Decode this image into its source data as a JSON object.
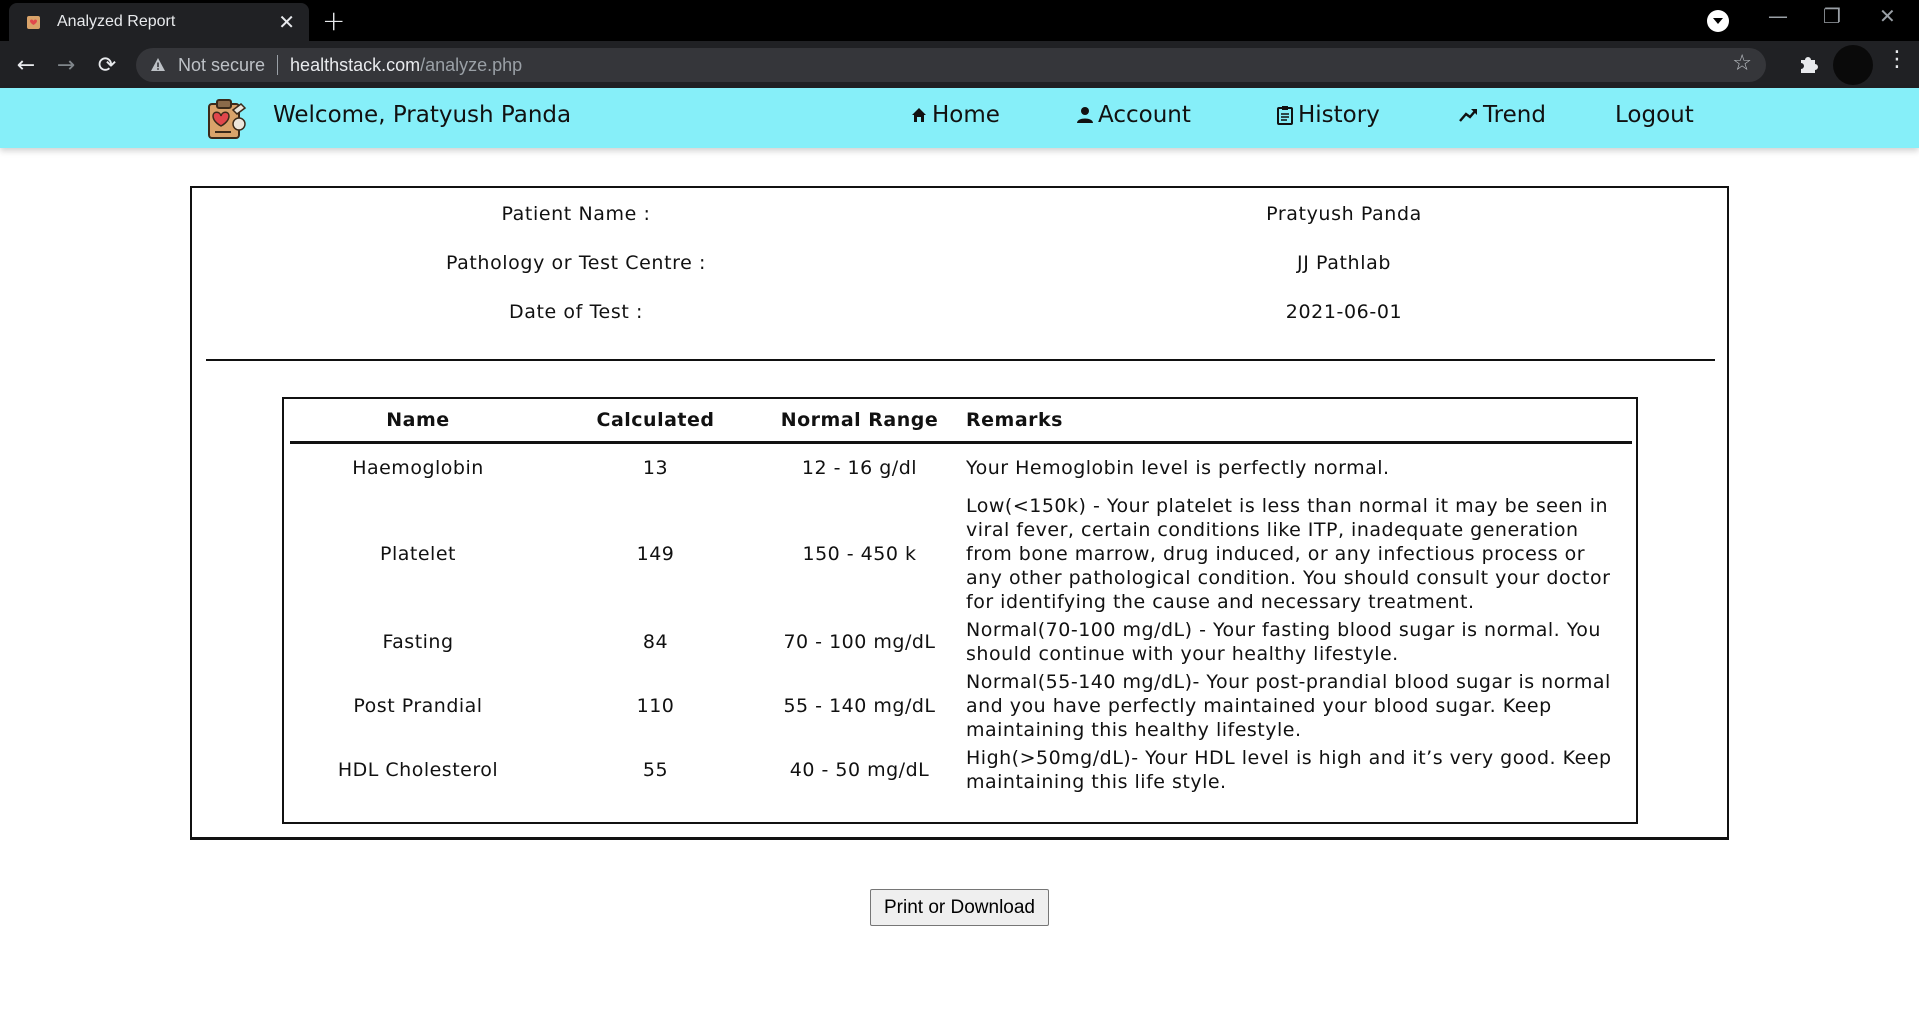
{
  "browser": {
    "tab_title": "Analyzed Report",
    "tab_close": "✕",
    "new_tab": "+",
    "security_label": "Not secure",
    "url_host": "healthstack.com",
    "url_path": "/analyze.php"
  },
  "navbar": {
    "welcome": "Welcome, Pratyush Panda",
    "links": [
      {
        "label": "Home",
        "icon": "home-icon"
      },
      {
        "label": "Account",
        "icon": "user-icon"
      },
      {
        "label": "History",
        "icon": "clipboard-icon"
      },
      {
        "label": "Trend",
        "icon": "trend-icon"
      },
      {
        "label": "Logout",
        "icon": ""
      }
    ],
    "background": "#86eff9"
  },
  "report": {
    "info": [
      {
        "label": "Patient Name :",
        "value": "Pratyush Panda"
      },
      {
        "label": "Pathology or Test Centre :",
        "value": "JJ Pathlab"
      },
      {
        "label": "Date of Test :",
        "value": "2021-06-01"
      }
    ],
    "table": {
      "headers": [
        "Name",
        "Calculated",
        "Normal Range",
        "Remarks"
      ],
      "rows": [
        {
          "name": "Haemoglobin",
          "calculated": "13",
          "range": "12 - 16 g/dl",
          "remarks": "Your Hemoglobin level is perfectly normal."
        },
        {
          "name": "Platelet",
          "calculated": "149",
          "range": "150 - 450 k",
          "remarks": "Low(<150k) - Your platelet is less than normal it may be seen in viral fever, certain conditions like ITP, inadequate generation from bone marrow, drug induced, or any infectious process or any other pathological condition. You should consult your doctor for identifying the cause and necessary treatment."
        },
        {
          "name": "Fasting",
          "calculated": "84",
          "range": "70 - 100 mg/dL",
          "remarks": "Normal(70-100 mg/dL) - Your fasting blood sugar is normal. You should continue with your healthy lifestyle."
        },
        {
          "name": "Post Prandial",
          "calculated": "110",
          "range": "55 - 140 mg/dL",
          "remarks": "Normal(55-140 mg/dL)- Your post-prandial blood sugar is normal and you have perfectly maintained your blood sugar. Keep maintaining this healthy lifestyle."
        },
        {
          "name": "HDL Cholesterol",
          "calculated": "55",
          "range": "40 - 50 mg/dL",
          "remarks": "High(>50mg/dL)- Your HDL level is high and it’s very good. Keep maintaining this life style."
        }
      ]
    }
  },
  "print_button": "Print or Download"
}
